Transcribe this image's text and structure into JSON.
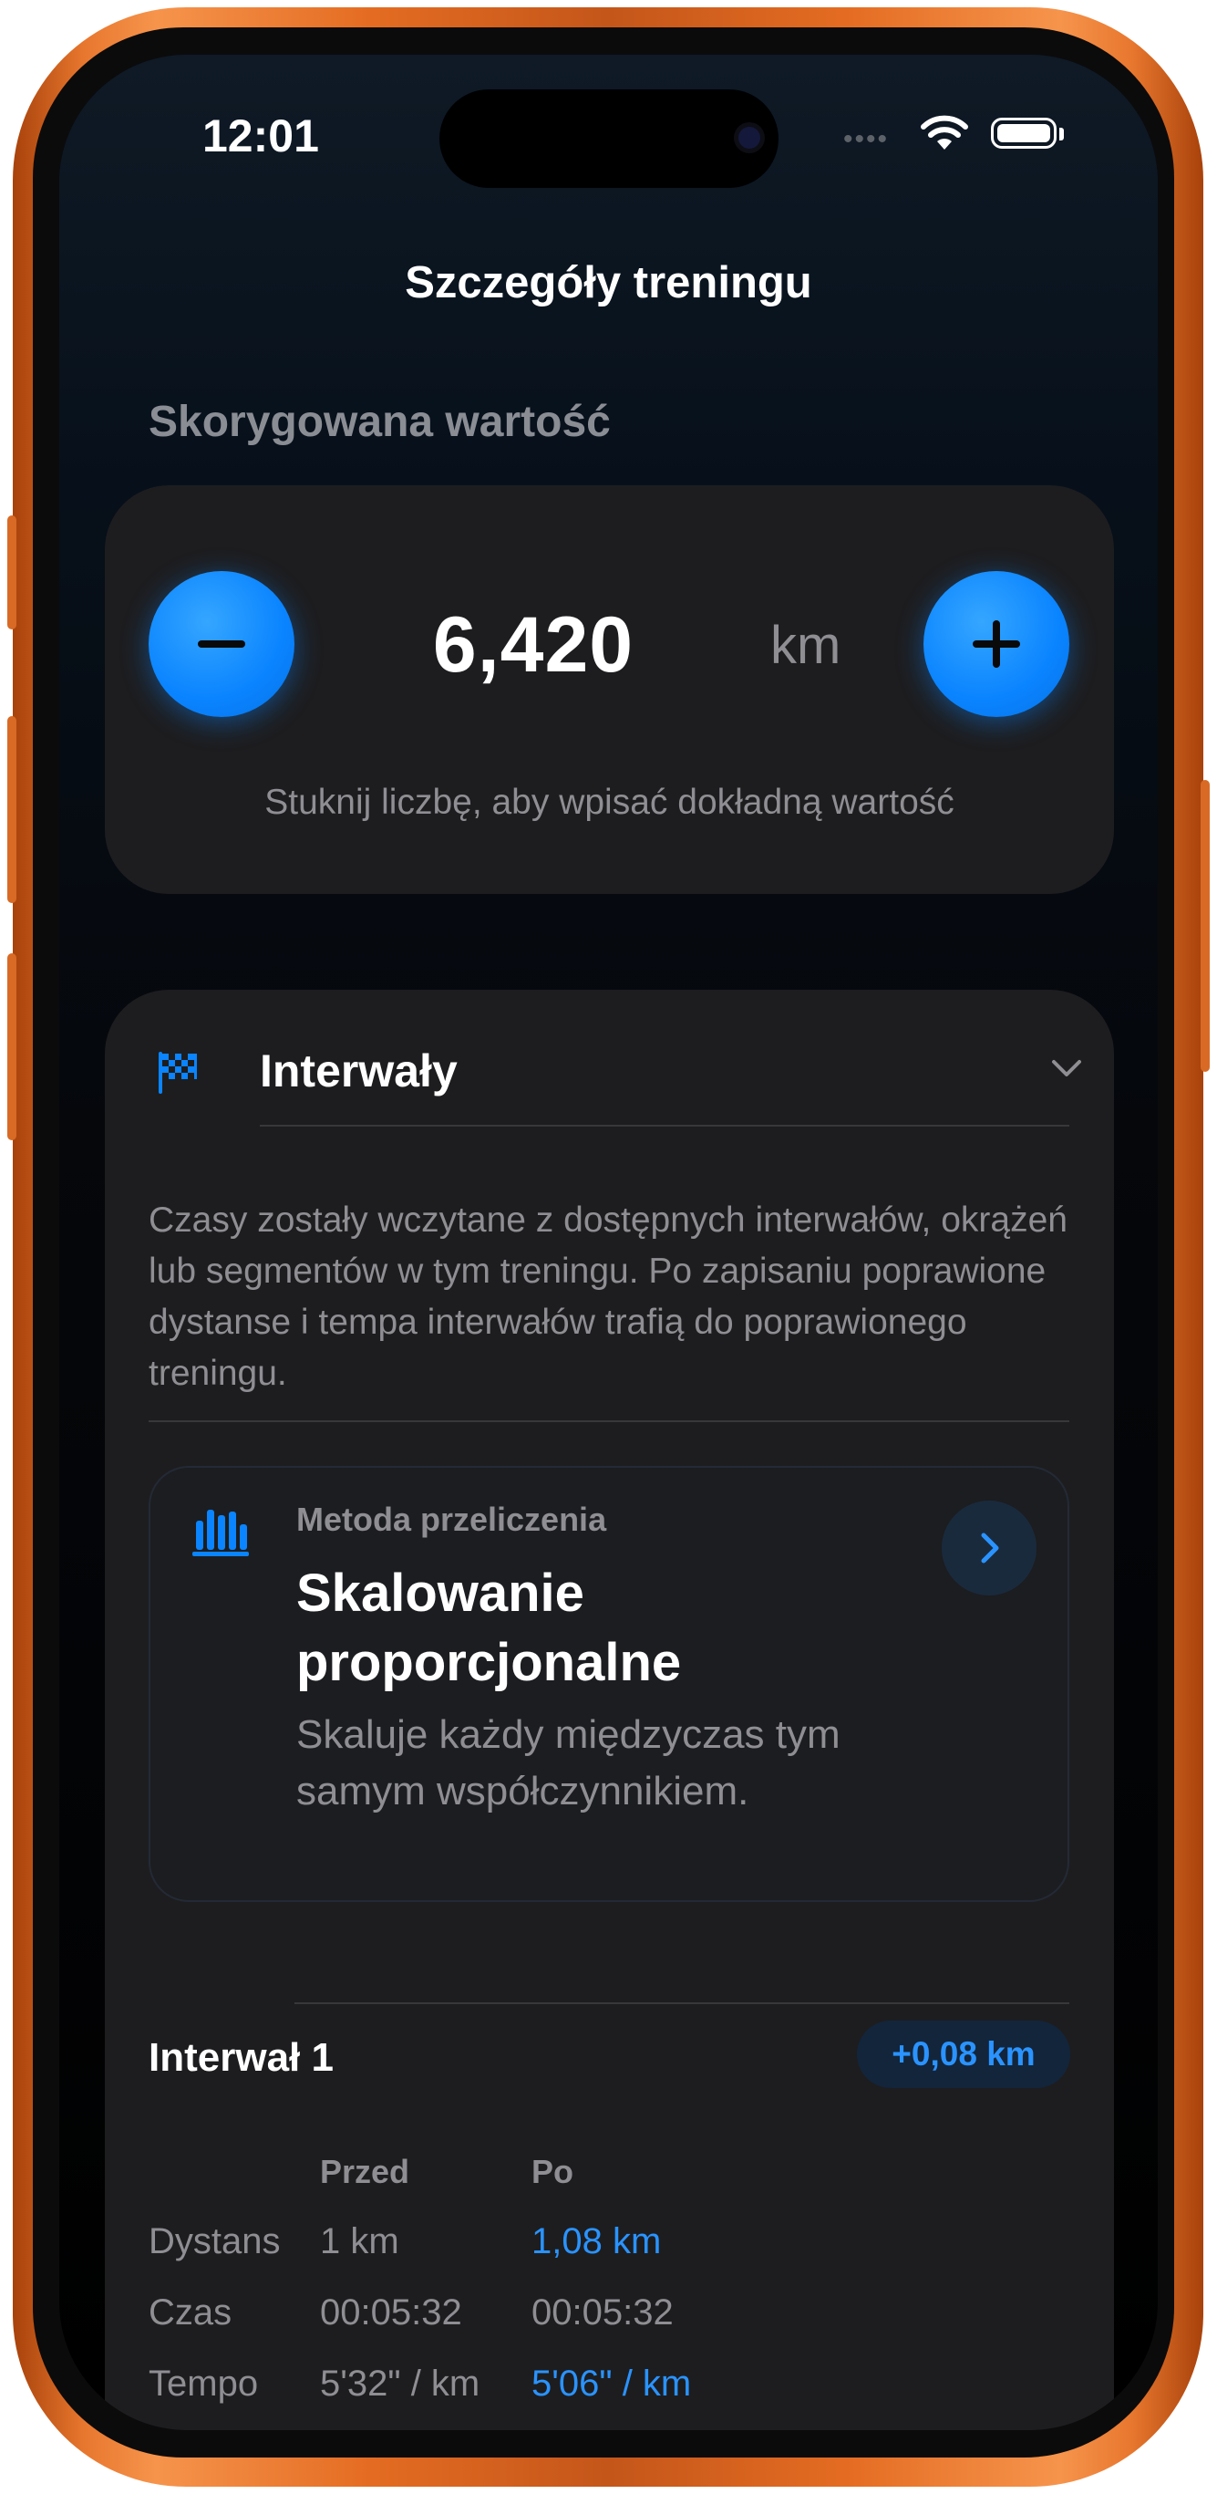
{
  "status_bar": {
    "time": "12:01",
    "dots": "••••"
  },
  "nav": {
    "title": "Szczegóły treningu"
  },
  "adjusted": {
    "section_label": "Skorygowana wartość",
    "value": "6,420",
    "unit": "km",
    "hint": "Stuknij liczbę, aby wpisać dokładną wartość"
  },
  "intervals": {
    "title": "Interwały",
    "description": "Czasy zostały wczytane z dostępnych interwałów, okrążeń lub segmentów w tym treningu. Po zapisaniu poprawione dystanse i tempa interwałów trafią do poprawionego treningu.",
    "method": {
      "caption": "Metoda przeliczenia",
      "title": "Skalowanie proporcjonalne",
      "description": "Skaluje każdy międzyczas tym samym współczynnikiem."
    },
    "interval_1": {
      "title": "Interwał 1",
      "delta": "+0,08 km",
      "col_before": "Przed",
      "col_after": "Po",
      "rows": [
        {
          "label": "Dystans",
          "before": "1 km",
          "after": "1,08 km"
        },
        {
          "label": "Czas",
          "before": "00:05:32",
          "after": "00:05:32"
        },
        {
          "label": "Tempo",
          "before": "5'32\" / km",
          "after": "5'06\" / km"
        }
      ]
    }
  },
  "colors": {
    "accent": "#0a84ff",
    "link": "#2a93ff",
    "card_background": "#1d1d1f",
    "secondary_text": "#8e8e93",
    "frame": "#e8772e"
  },
  "icons": [
    "minus-icon",
    "plus-icon",
    "flag-checkered-icon",
    "chevron-down-icon",
    "bar-chart-icon",
    "chevron-right-icon",
    "wifi-icon",
    "battery-icon"
  ]
}
